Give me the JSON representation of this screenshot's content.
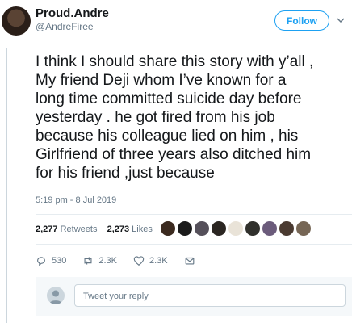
{
  "author": {
    "display_name": "Proud.Andre",
    "handle": "@AndreFiree"
  },
  "follow_label": "Follow",
  "tweet": {
    "lines": [
      "I think I should share this story with y’all ,",
      "My friend Deji whom I’ve known for a",
      "long time committed suicide day before",
      "yesterday . he got fired from his job",
      "because his colleague lied on him , his",
      "Girlfriend of three years also ditched him",
      "for his friend ,just because"
    ],
    "timestamp": "5:19 pm - 8 Jul 2019"
  },
  "stats": {
    "retweets_count": "2,277",
    "retweets_label": "Retweets",
    "likes_count": "2,273",
    "likes_label": "Likes"
  },
  "actions": {
    "replies": "530",
    "retweets": "2.3K",
    "likes": "2.3K"
  },
  "reply": {
    "placeholder": "Tweet your reply"
  },
  "icons": [
    "chevron-down-icon",
    "reply-icon",
    "retweet-icon",
    "like-icon",
    "direct-message-icon",
    "default-avatar-icon"
  ],
  "colors": {
    "accent": "#1da1f2",
    "secondary_text": "#657786",
    "reply_bg": "#f5f8fa"
  }
}
